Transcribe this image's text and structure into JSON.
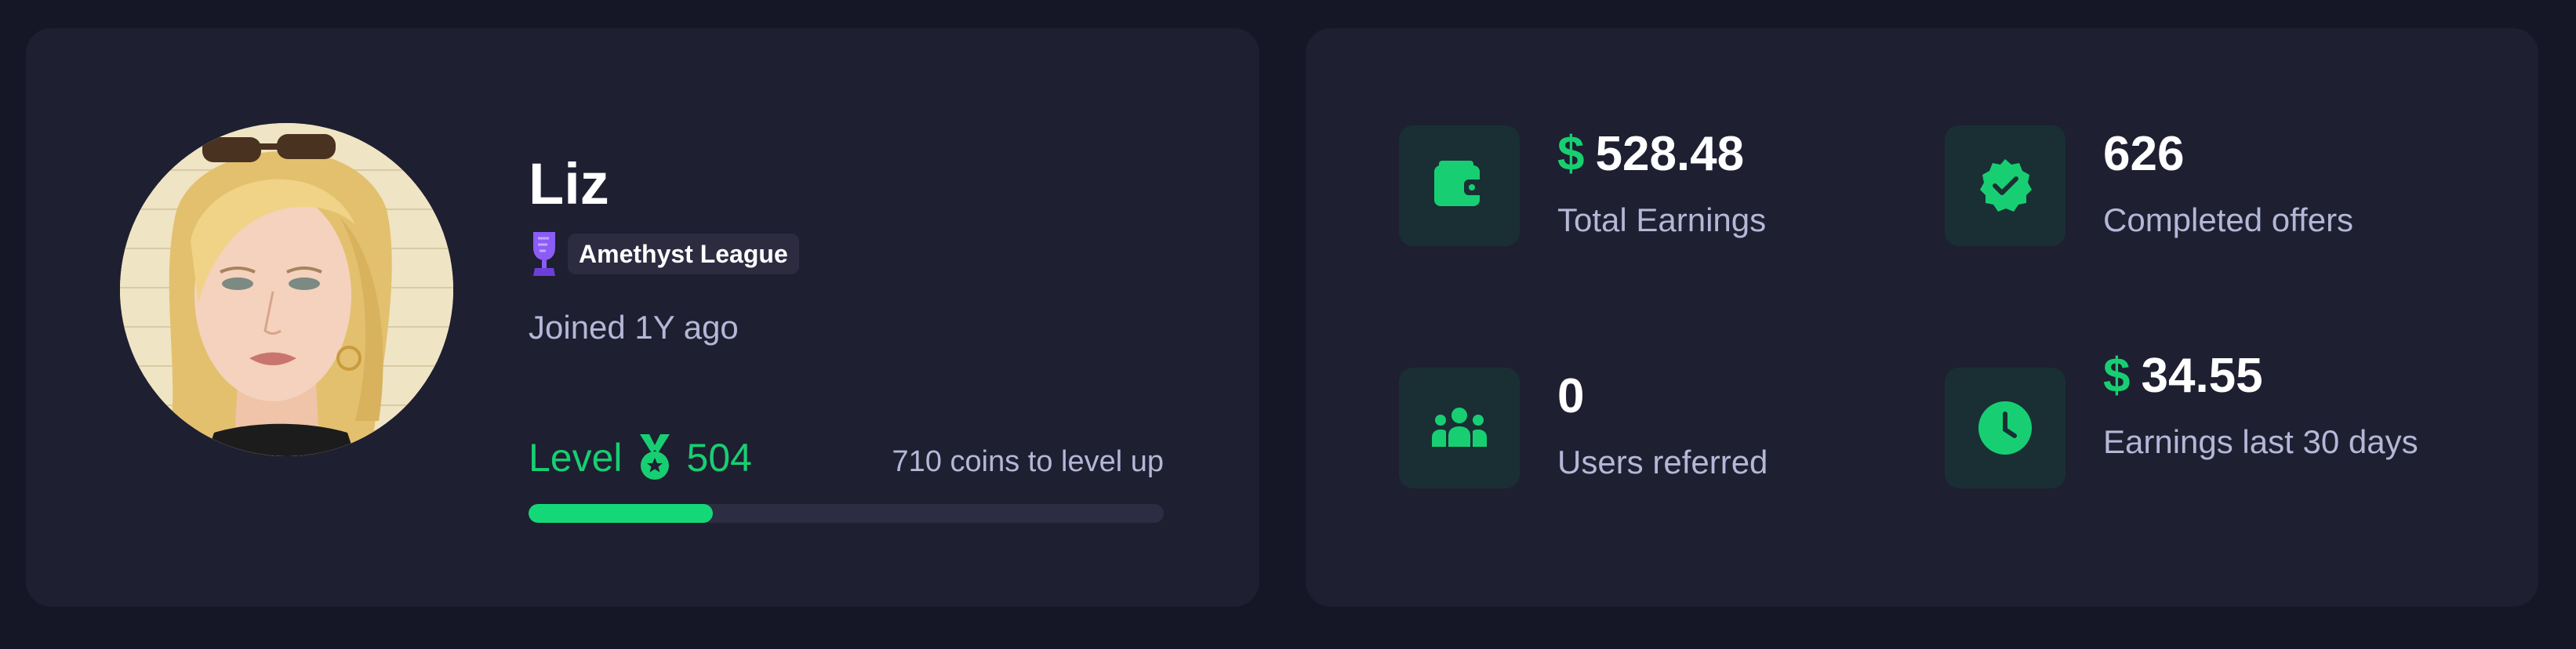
{
  "profile": {
    "name": "Liz",
    "league": "Amethyst League",
    "joined": "Joined 1Y ago",
    "level_label": "Level",
    "level": "504",
    "coins_to_level_up": "710 coins to level up",
    "progress_fraction": 0.29
  },
  "stats": {
    "total_earnings": {
      "currency": "$",
      "value": "528.48",
      "label": "Total Earnings",
      "icon": "wallet-icon"
    },
    "completed_offers": {
      "value": "626",
      "label": "Completed offers",
      "icon": "verified-badge-icon"
    },
    "users_referred": {
      "value": "0",
      "label": "Users referred",
      "icon": "users-icon"
    },
    "earnings_30_days": {
      "currency": "$",
      "value": "34.55",
      "label": "Earnings last 30 days",
      "icon": "clock-icon"
    }
  },
  "colors": {
    "accent": "#17cf72",
    "card": "#1e1f31",
    "background": "#151726",
    "league": "#8b5cf6"
  }
}
